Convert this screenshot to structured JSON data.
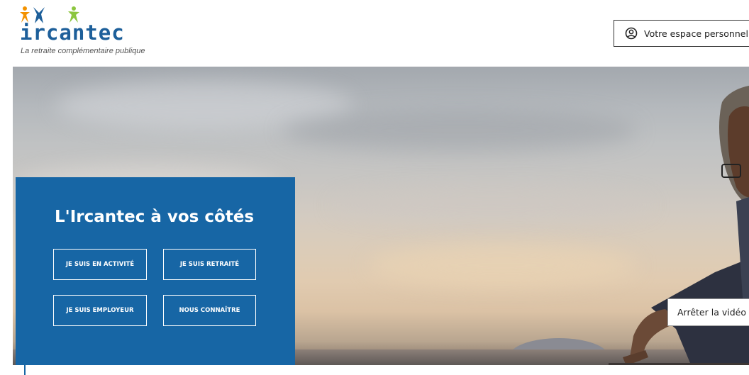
{
  "header": {
    "logo": {
      "name": "ircantec",
      "tagline": "La retraite complémentaire publique",
      "figure_colors": [
        "#f39200",
        "#1d5f9a",
        "#8cc63f"
      ]
    },
    "personal_space": {
      "label": "Votre espace personnel",
      "icon": "user-circle-icon"
    }
  },
  "hero": {
    "panel": {
      "title": "L'Ircantec à vos côtés",
      "background": "#1766a5",
      "buttons": [
        {
          "label": "JE SUIS EN ACTIVITÉ"
        },
        {
          "label": "JE SUIS RETRAITÉ"
        },
        {
          "label": "JE SUIS EMPLOYEUR"
        },
        {
          "label": "NOUS CONNAÎTRE"
        }
      ]
    },
    "video_control": {
      "label": "Arrêter la vidéo"
    }
  }
}
